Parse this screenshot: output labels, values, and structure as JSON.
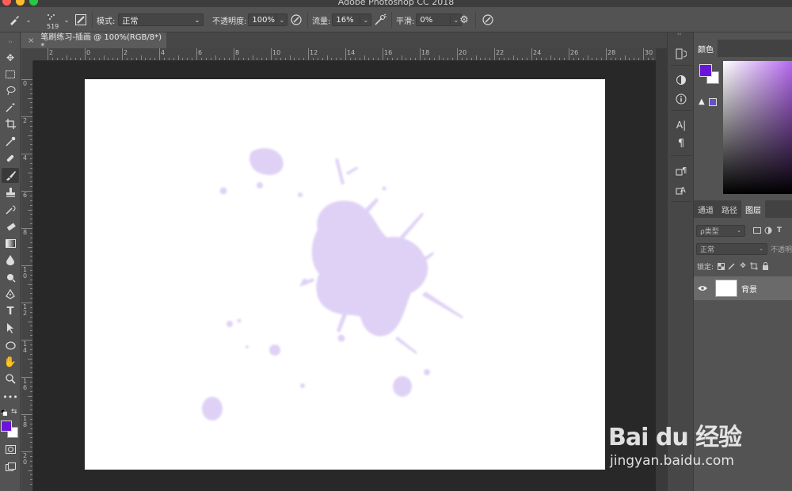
{
  "window": {
    "title": "Adobe Photoshop CC 2018"
  },
  "options_bar": {
    "brush_size": "519",
    "mode_label": "模式:",
    "mode_value": "正常",
    "opacity_label": "不透明度:",
    "opacity_value": "100%",
    "flow_label": "流量:",
    "flow_value": "16%",
    "smoothing_label": "平滑:",
    "smoothing_value": "0%"
  },
  "document": {
    "tab_title": "笔刷练习-插画 @ 100%(RGB/8*) *",
    "close_glyph": "×"
  },
  "rulers": {
    "h_labels": [
      "2",
      "0",
      "2",
      "4",
      "6",
      "8",
      "10",
      "12",
      "14",
      "16",
      "18",
      "20",
      "22",
      "24",
      "26",
      "28",
      "30"
    ],
    "v_labels": [
      "0",
      "2",
      "4",
      "6",
      "8",
      "10",
      "12",
      "14",
      "16",
      "18",
      "20"
    ]
  },
  "colors": {
    "foreground": "#6a16d8",
    "background": "#ffffff",
    "splatter": "#dccdf4"
  },
  "color_panel": {
    "tab": "颜色"
  },
  "layers_panel": {
    "tabs": [
      "通道",
      "路径",
      "图层"
    ],
    "active_tab": "图层",
    "filter_label": "ρ类型",
    "blend_mode": "正常",
    "opacity_label": "不透明",
    "lock_label": "锁定:",
    "layer_name": "背景"
  },
  "watermark": {
    "logo": "Bai du 经验",
    "url": "jingyan.baidu.com"
  }
}
